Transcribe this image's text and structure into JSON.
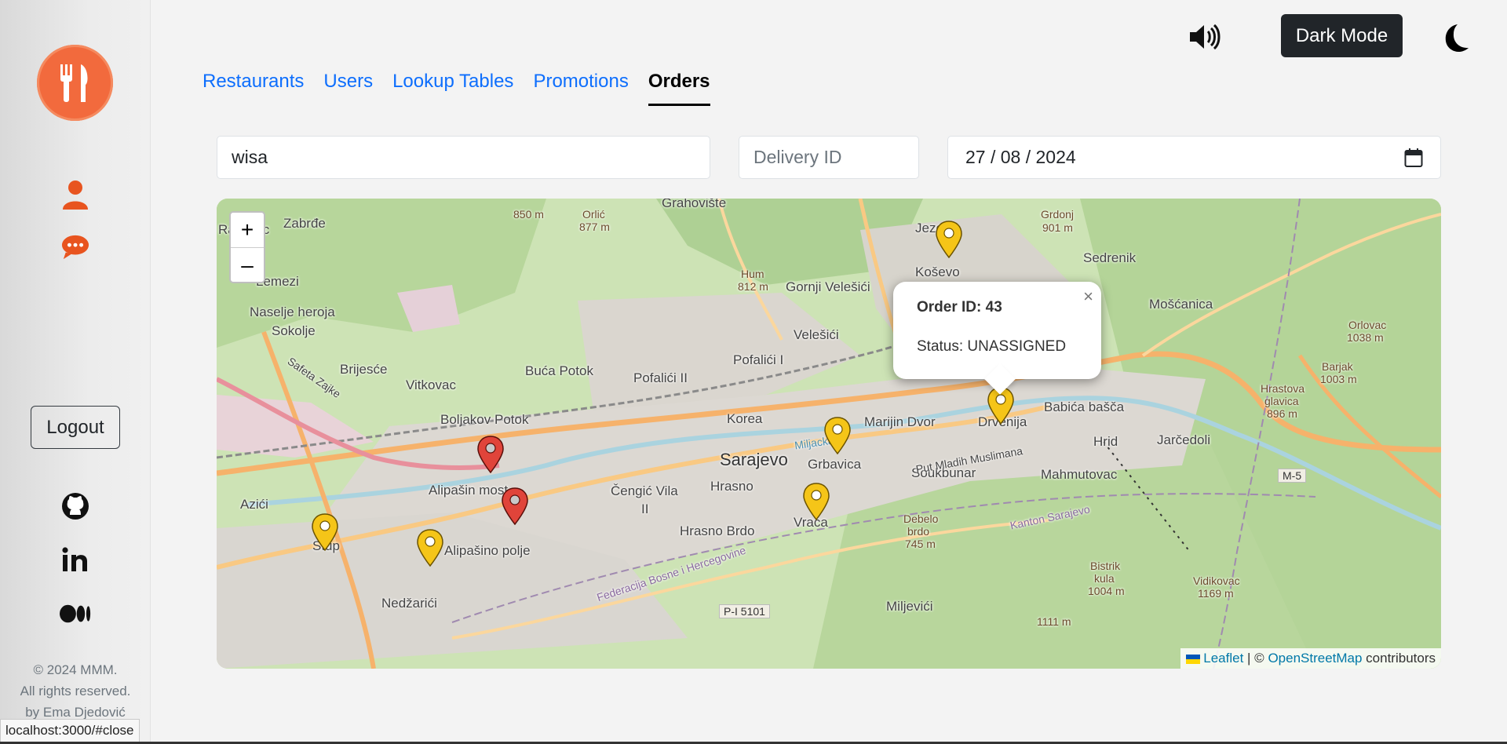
{
  "sidebar": {
    "logo_icon": "fork-knife-icon",
    "nav_icons": [
      "user-icon",
      "chat-icon"
    ],
    "logout_label": "Logout",
    "social_icons": [
      "github-icon",
      "linkedin-icon",
      "medium-icon"
    ],
    "footer": [
      "© 2024 MMM.",
      "All rights reserved.",
      "by Ema Djedović"
    ]
  },
  "status_bar_url": "localhost:3000/#close",
  "topbar": {
    "sound_icon": "speaker-icon",
    "dark_mode_label": "Dark Mode",
    "theme_icon": "moon-icon"
  },
  "tabs": [
    {
      "label": "Restaurants",
      "active": false
    },
    {
      "label": "Users",
      "active": false
    },
    {
      "label": "Lookup Tables",
      "active": false
    },
    {
      "label": "Promotions",
      "active": false
    },
    {
      "label": "Orders",
      "active": true
    }
  ],
  "filters": {
    "restaurant_value": "wisa",
    "delivery_placeholder": "Delivery ID",
    "date_value": "27 / 08 / 2024"
  },
  "map": {
    "zoom_in": "+",
    "zoom_out": "–",
    "labels": [
      "Rajlovac",
      "Zabrđe",
      "Grahovište",
      "Jezero",
      "Grdonj",
      "901 m",
      "Sedrenik",
      "Lemezi",
      "Naselje heroja",
      "Sokolje",
      "Hum",
      "812 m",
      "Gornji Velešići",
      "Koševo",
      "Velešići",
      "Mošćanica",
      "Brijesće",
      "Buća Potok",
      "Pofalići I",
      "Pofalići II",
      "Vitkovac",
      "Boljakov Potok",
      "Korea",
      "Marijin Dvor",
      "Drvenija",
      "Babića bašča",
      "Hrid",
      "Jarčedoli",
      "Sarajevo",
      "Grbavica",
      "Soukbunar",
      "Mahmutovac",
      "Alipašin most",
      "Čengić Vila",
      "II",
      "Hrasno",
      "Azići",
      "Stup",
      "Alipašino polje",
      "Hrasno Brdo",
      "Vraca",
      "Debelo",
      "brdo",
      "745 m",
      "Nedžarići",
      "Miljevići",
      "Bistrik",
      "kula",
      "1004 m",
      "Vidikovac",
      "1169 m",
      "1111 m",
      "Orlovac",
      "1038 m",
      "Barjak",
      "1003 m",
      "Hrastova",
      "glavica",
      "896 m",
      "Orlić",
      "877 m",
      "850 m",
      "Safeta Zajke",
      "Kanton Sarajevo",
      "Federacija Bosne i Hercegovine",
      "P-I 5101",
      "M-5",
      "Put Mladih Muslimana",
      "Miljacka"
    ],
    "markers": [
      {
        "color": "yellow"
      },
      {
        "color": "yellow"
      },
      {
        "color": "yellow"
      },
      {
        "color": "yellow"
      },
      {
        "color": "yellow"
      },
      {
        "color": "yellow"
      },
      {
        "color": "red"
      },
      {
        "color": "red"
      }
    ],
    "popup": {
      "title": "Order ID: 43",
      "status": "Status: UNASSIGNED",
      "close": "×"
    },
    "attribution": {
      "leaflet": "Leaflet",
      "separator": " | © ",
      "osm": "OpenStreetMap",
      "suffix": " contributors"
    }
  },
  "colors": {
    "brand": "#f26a3d",
    "link": "#0d6efd",
    "dark_button": "#212529",
    "marker_yellow": "#f5c518",
    "marker_red": "#e0443a"
  }
}
